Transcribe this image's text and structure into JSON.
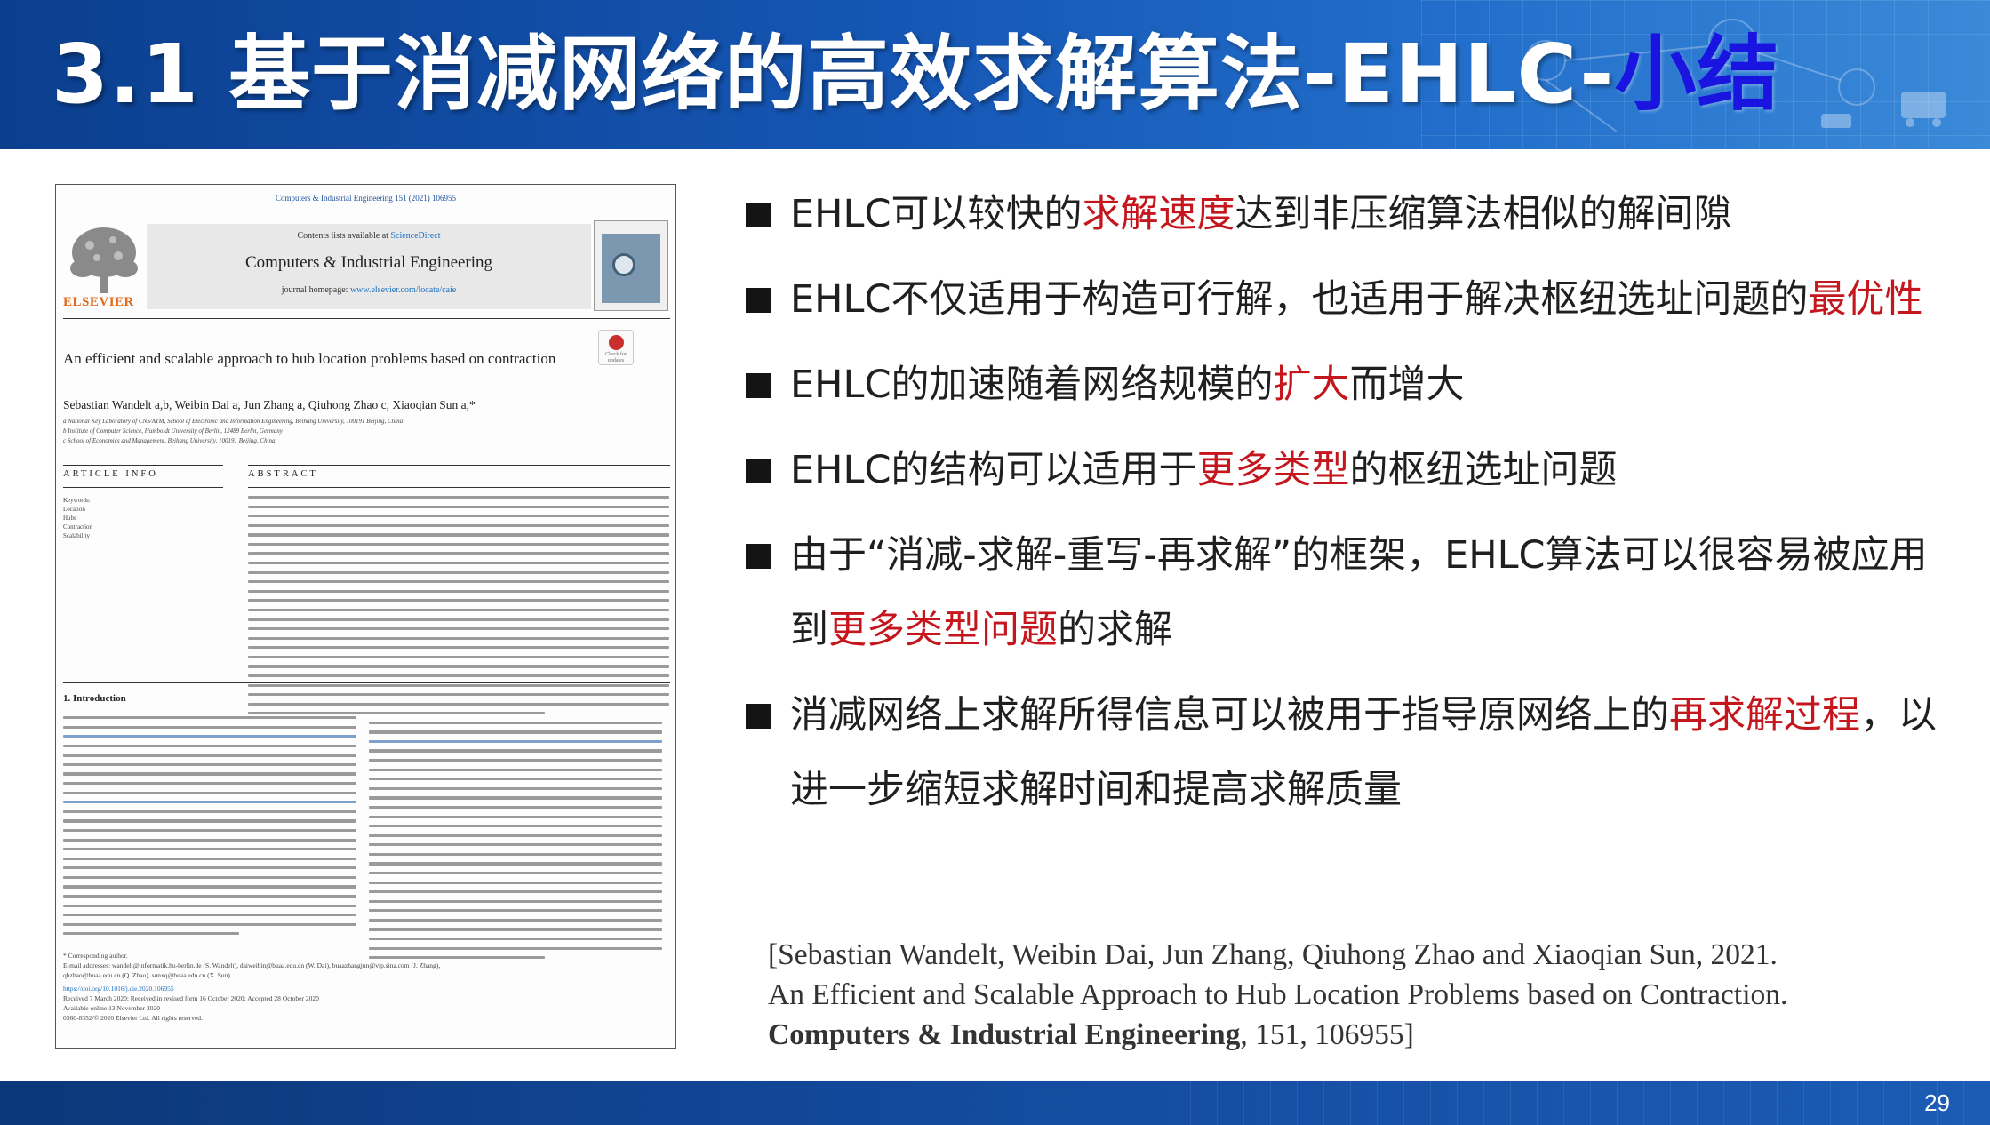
{
  "header": {
    "title_main": "3.1 基于消减网络的高效求解算法-EHLC-",
    "title_accent": "小结"
  },
  "paper": {
    "journal_top": "Computers & Industrial Engineering 151 (2021) 106955",
    "contents_prefix": "Contents lists available at ",
    "contents_link": "ScienceDirect",
    "journal_name": "Computers & Industrial Engineering",
    "homepage_prefix": "journal homepage: ",
    "homepage_link": "www.elsevier.com/locate/caie",
    "publisher": "ELSEVIER",
    "check_updates": "Check for updates",
    "title": "An efficient and scalable approach to hub location problems based on contraction",
    "authors": "Sebastian Wandelt a,b, Weibin Dai a, Jun Zhang a, Qiuhong Zhao c, Xiaoqian Sun a,*",
    "affiliations": [
      "a National Key Laboratory of CNS/ATM, School of Electronic and Information Engineering, Beihang University, 100191 Beijing, China",
      "b Institute of Computer Science, Humboldt University of Berlin, 12489 Berlin, Germany",
      "c School of Economics and Management, Beihang University, 100191 Beijing, China"
    ],
    "article_info_head": "ARTICLE INFO",
    "abstract_head": "ABSTRACT",
    "keywords": [
      "Keywords:",
      "Location",
      "Hubs",
      "Contraction",
      "Scalability"
    ],
    "intro_head": "1. Introduction",
    "footnotes": [
      "* Corresponding author.",
      "E-mail addresses: wandelt@informatik.hu-berlin.de (S. Wandelt), daiweibin@buaa.edu.cn (W. Dai), buaazhangjun@vip.sina.com (J. Zhang),",
      "qhzhao@buaa.edu.cn (Q. Zhao), sunxq@buaa.edu.cn (X. Sun).",
      "https://doi.org/10.1016/j.cie.2020.106955",
      "Received 7 March 2020; Received in revised form 16 October 2020; Accepted 28 October 2020",
      "Available online 13 November 2020",
      "0360-8352/© 2020 Elsevier Ltd. All rights reserved."
    ]
  },
  "bullets": [
    {
      "parts": [
        {
          "t": "EHLC可以较快的",
          "hl": false
        },
        {
          "t": "求解速度",
          "hl": true
        },
        {
          "t": "达到非压缩算法相似的解间隙",
          "hl": false
        }
      ]
    },
    {
      "parts": [
        {
          "t": "EHLC不仅适用于构造可行解，也适用于解决枢纽选址问题的",
          "hl": false
        },
        {
          "t": "最优性",
          "hl": true
        }
      ]
    },
    {
      "parts": [
        {
          "t": "EHLC的加速随着网络规模的",
          "hl": false
        },
        {
          "t": "扩大",
          "hl": true
        },
        {
          "t": "而增大",
          "hl": false
        }
      ]
    },
    {
      "parts": [
        {
          "t": "EHLC的结构可以适用于",
          "hl": false
        },
        {
          "t": "更多类型",
          "hl": true
        },
        {
          "t": "的枢纽选址问题",
          "hl": false
        }
      ]
    },
    {
      "parts": [
        {
          "t": "由于“消减-求解-重写-再求解”的框架，EHLC算法可以很容易被应用到",
          "hl": false
        },
        {
          "t": "更多类型问题",
          "hl": true
        },
        {
          "t": "的求解",
          "hl": false
        }
      ]
    },
    {
      "parts": [
        {
          "t": "消减网络上求解所得信息可以被用于指导原网络上的",
          "hl": false
        },
        {
          "t": "再求解过程",
          "hl": true
        },
        {
          "t": "，以进一步缩短求解时间和提高求解质量",
          "hl": false
        }
      ]
    }
  ],
  "citation": {
    "line1": "[Sebastian Wandelt, Weibin Dai, Jun Zhang, Qiuhong Zhao and Xiaoqian Sun, 2021.",
    "line2": "An Efficient and Scalable Approach to Hub Location Problems based on Contraction.",
    "journal": "Computers & Industrial Engineering",
    "rest": ", 151, 106955]"
  },
  "page_number": "29",
  "colors": {
    "header_blue": "#1556b4",
    "accent_blue": "#1a14e0",
    "highlight_red": "#c4161c"
  }
}
